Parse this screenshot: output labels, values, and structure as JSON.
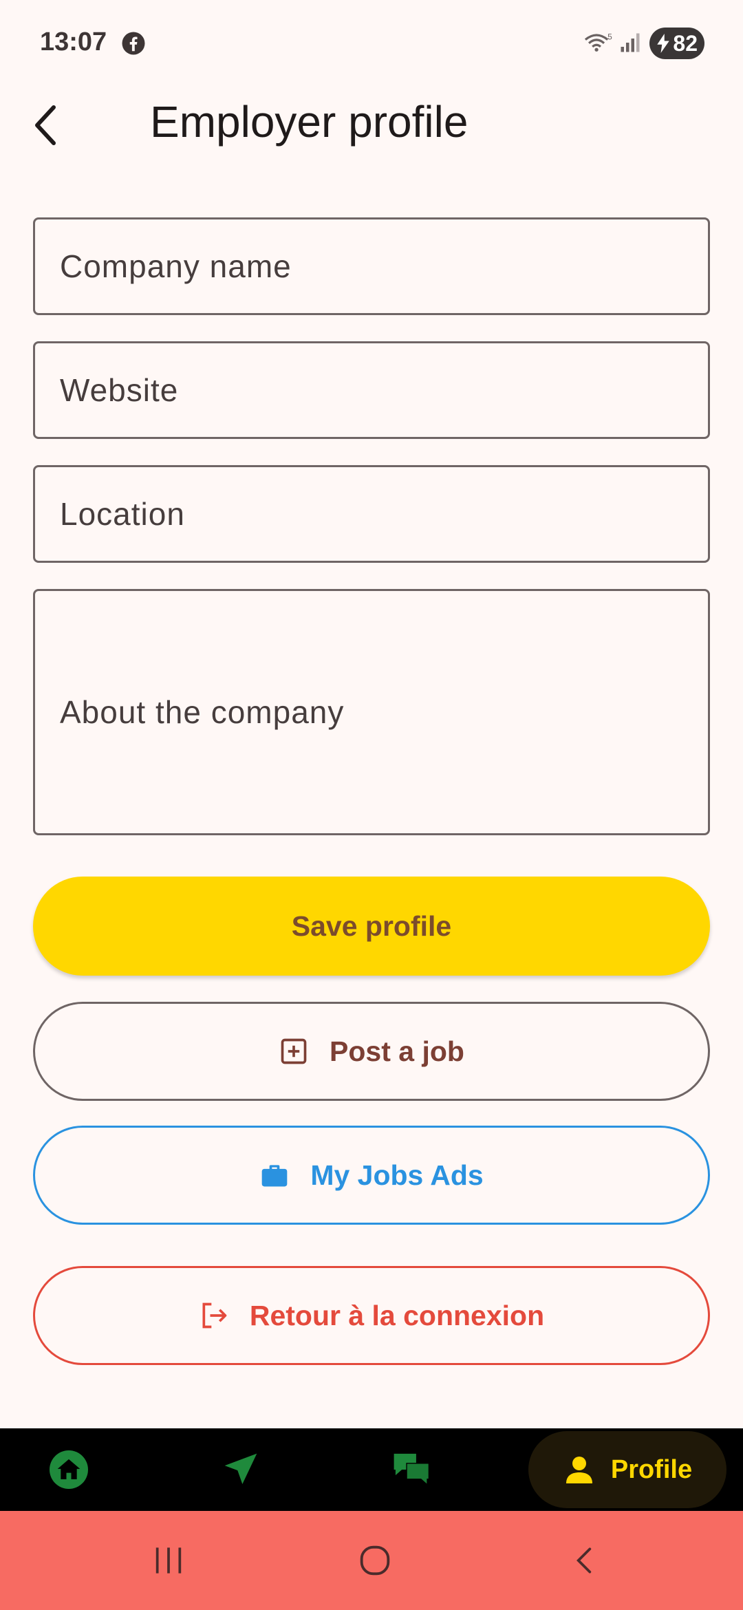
{
  "status_bar": {
    "time": "13:07",
    "battery": "82",
    "icons": [
      "facebook-icon",
      "wifi-icon",
      "signal-icon",
      "battery-charging-icon"
    ]
  },
  "header": {
    "title": "Employer profile",
    "back_icon": "chevron-left-icon"
  },
  "form": {
    "company_name_placeholder": "Company name",
    "website_placeholder": "Website",
    "location_placeholder": "Location",
    "about_placeholder": "About the company"
  },
  "actions": {
    "save_label": "Save profile",
    "post_job_label": "Post a job",
    "my_jobs_label": "My Jobs Ads",
    "logout_label": "Retour à la connexion"
  },
  "bottom_nav": {
    "items": [
      {
        "icon": "home-icon",
        "label": ""
      },
      {
        "icon": "send-icon",
        "label": ""
      },
      {
        "icon": "chat-icon",
        "label": ""
      },
      {
        "icon": "person-icon",
        "label": "Profile"
      }
    ]
  },
  "colors": {
    "background": "#fff8f6",
    "accent_yellow": "#ffd700",
    "blue": "#2a92e0",
    "red": "#e44a3c",
    "nav_green": "#1f8a3c",
    "system_nav": "#f76b62"
  }
}
